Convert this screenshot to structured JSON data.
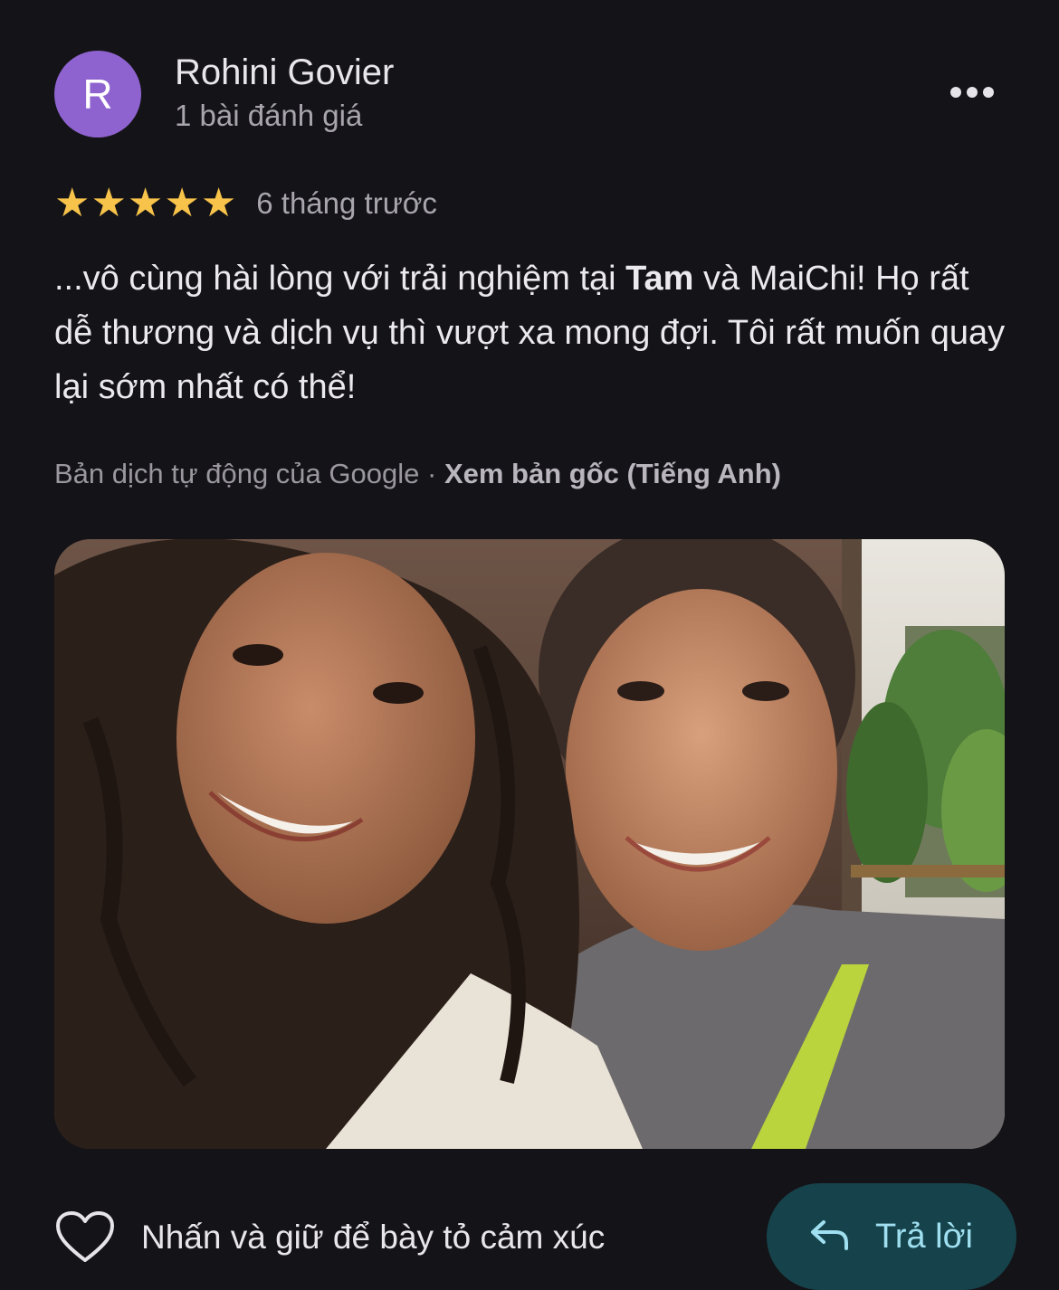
{
  "author": {
    "initial": "R",
    "name": "Rohini Govier",
    "review_count": "1 bài đánh giá",
    "avatar_color": "#8e63cf"
  },
  "more_menu_icon": "more-horizontal-icon",
  "review": {
    "rating": 5,
    "rating_max": 5,
    "star_color": "#f7c34a",
    "time_ago": "6 tháng trước",
    "text_part1": "...vô cùng hài lòng với trải nghiệm tại ",
    "text_bold": "Tam",
    "text_part2": " và MaiChi! Họ rất dễ thương và dịch vụ thì vượt xa mong đợi. Tôi rất muốn quay lại sớm nhất có thể!"
  },
  "translation": {
    "note": "Bản dịch tự động của Google",
    "separator": " · ",
    "view_original": "Xem bản gốc (Tiếng Anh)"
  },
  "actions": {
    "react_icon": "heart-outline-icon",
    "react_label": "Nhấn và giữ để bày tỏ cảm xúc",
    "reply_icon": "reply-arrow-icon",
    "reply_label": "Trả lời",
    "reply_bg": "#16434b",
    "reply_fg": "#9fdff0"
  }
}
